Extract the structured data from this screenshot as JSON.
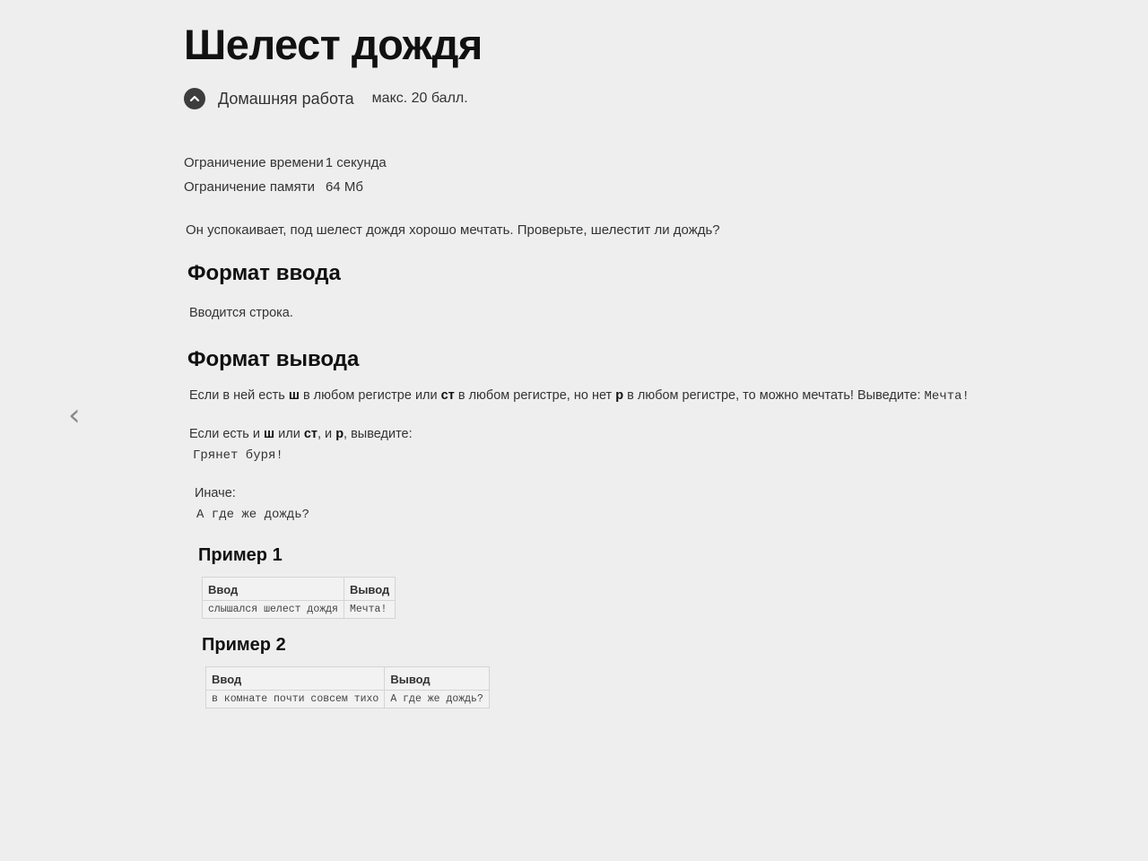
{
  "problem": {
    "title": "Шелест дождя",
    "type_label": "Домашняя работа",
    "max_score": "макс. 20 балл.",
    "time_limit_label": "Ограничение времени",
    "time_limit_value": "1 секунда",
    "memory_limit_label": "Ограничение памяти",
    "memory_limit_value": "64 Мб",
    "legend": "Он успокаивает, под шелест дождя хорошо мечтать. Проверьте, шелестит ли дождь?"
  },
  "input_format": {
    "heading": "Формат ввода",
    "text": "Вводится строка."
  },
  "output_format": {
    "heading": "Формат вывода",
    "rule1_a": "Если в ней есть ",
    "rule1_b1": "ш",
    "rule1_c": " в любом регистре или ",
    "rule1_b2": "ст",
    "rule1_d": " в любом регистре, но нет ",
    "rule1_b3": "р",
    "rule1_e": " в любом регистре, то можно мечтать! Выведите: ",
    "rule1_out": "Мечта!",
    "rule2_a": "Если есть и ",
    "rule2_b1": "ш",
    "rule2_c": " или ",
    "rule2_b2": "ст",
    "rule2_d": ", и ",
    "rule2_b3": "р",
    "rule2_e": ", выведите:",
    "rule2_out": "Грянет буря!",
    "rule3": "Иначе:",
    "rule3_out": "А где же дождь?"
  },
  "examples": [
    {
      "heading": "Пример 1",
      "input_header": "Ввод",
      "output_header": "Вывод",
      "input": "слышался шелест дождя",
      "output": "Мечта!"
    },
    {
      "heading": "Пример 2",
      "input_header": "Ввод",
      "output_header": "Вывод",
      "input": "в комнате почти совсем тихо",
      "output": "А где же дождь?"
    }
  ],
  "icons": {
    "back": "chevron-left-icon",
    "homework": "homework-badge-icon"
  },
  "colors": {
    "background": "#eeeeee",
    "text": "#222222",
    "heading": "#111111"
  }
}
